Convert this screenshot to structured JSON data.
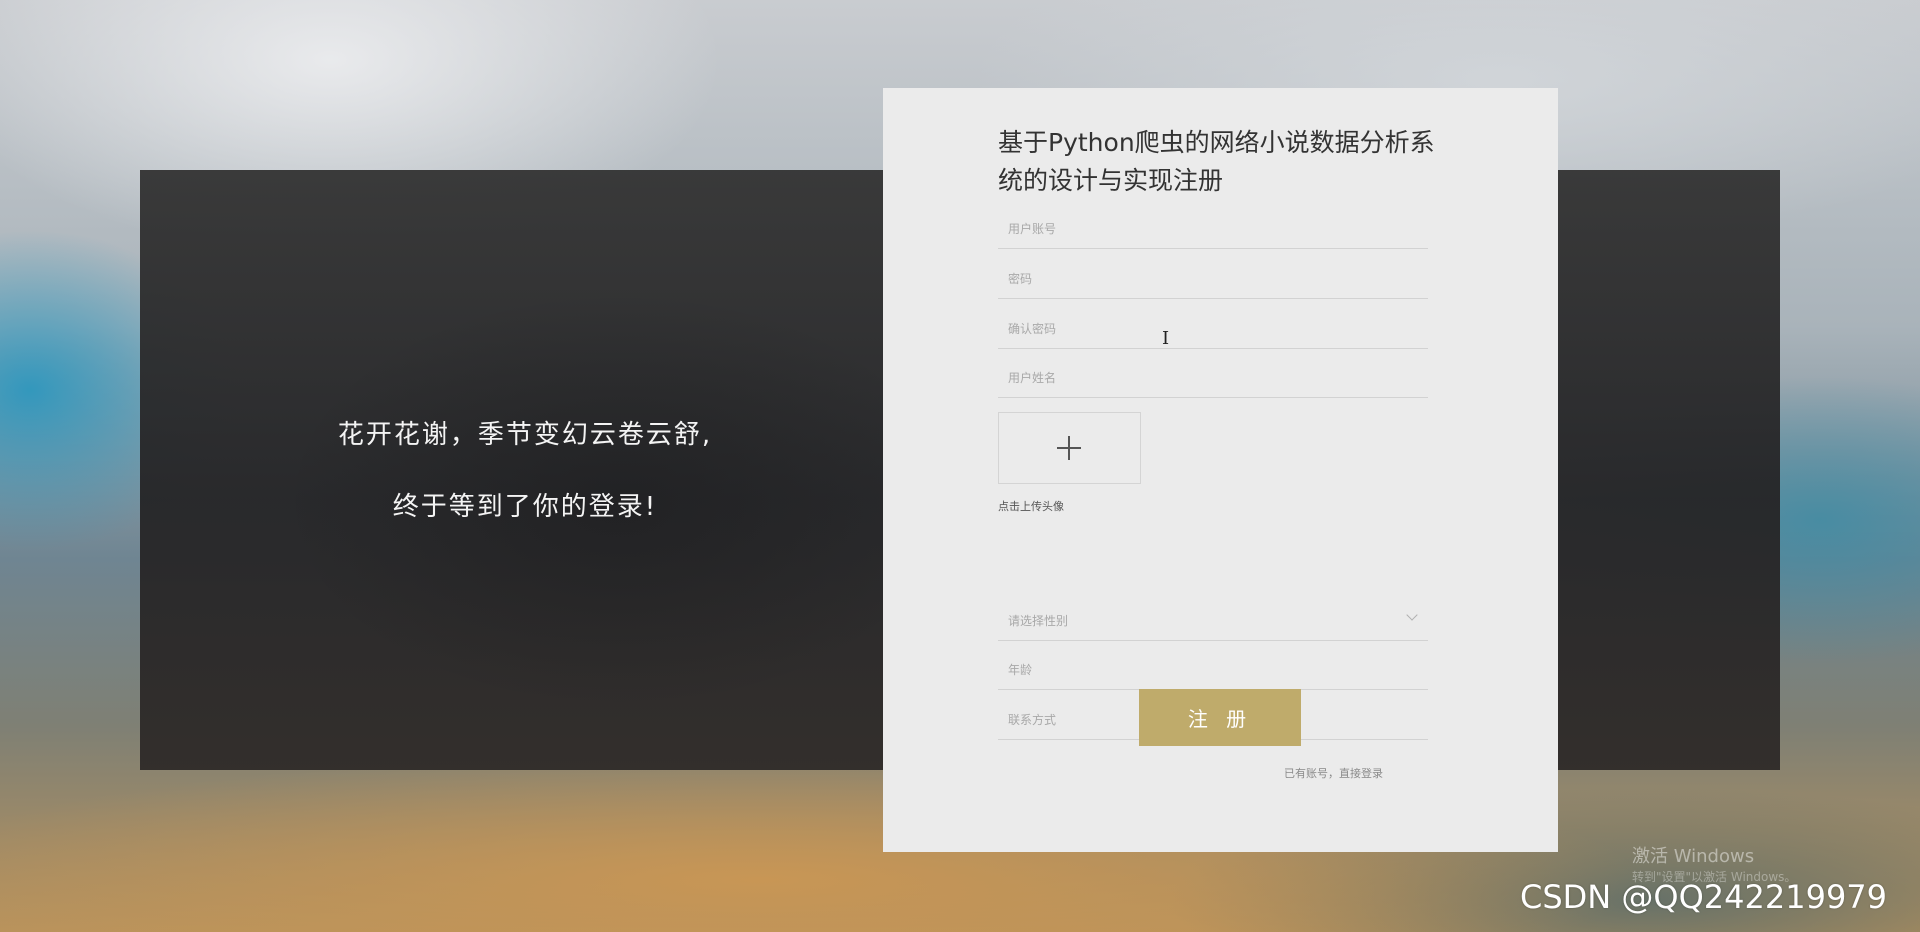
{
  "slogan": {
    "line1": "花开花谢，季节变幻云卷云舒,",
    "line2": "终于等到了你的登录!"
  },
  "form": {
    "title": "基于Python爬虫的网络小说数据分析系统的设计与实现注册",
    "account_placeholder": "用户账号",
    "password_placeholder": "密码",
    "confirm_placeholder": "确认密码",
    "name_placeholder": "用户姓名",
    "upload_label": "点击上传头像",
    "gender_placeholder": "请选择性别",
    "age_placeholder": "年龄",
    "contact_placeholder": "联系方式",
    "submit_label": "注 册",
    "login_link": "已有账号，直接登录"
  },
  "watermark": {
    "activate": "激活 Windows",
    "activate_sub": "转到\"设置\"以激活 Windows。",
    "csdn": "CSDN @QQ242219979"
  },
  "colors": {
    "accent": "#bfab6b",
    "card_bg": "#ebebeb",
    "panel_bg": "#333333"
  }
}
